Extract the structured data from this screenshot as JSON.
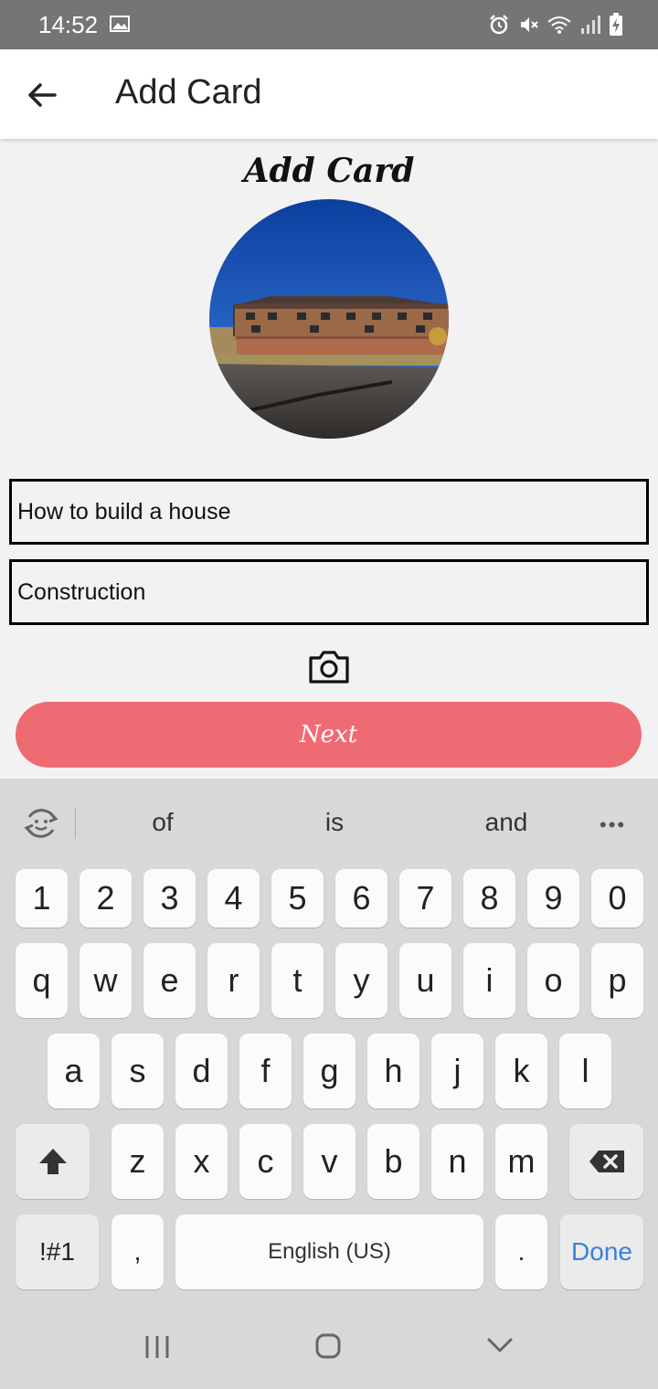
{
  "status_bar": {
    "time": "14:52",
    "icons": [
      "image-icon",
      "alarm-icon",
      "mute-icon",
      "wifi-icon",
      "signal-icon",
      "battery-icon"
    ]
  },
  "app_bar": {
    "title": "Add Card",
    "back_icon": "arrow-left-icon"
  },
  "content": {
    "script_title": "Add Card",
    "photo_description_icon": "house-photo",
    "title_field": {
      "value": "How to build a house"
    },
    "category_field": {
      "value": "Construction"
    },
    "camera_icon": "camera-icon",
    "next_label": "Next",
    "next_color": "#ef6b73"
  },
  "keyboard": {
    "suggestions": [
      "of",
      "is",
      "and"
    ],
    "number_row": [
      "1",
      "2",
      "3",
      "4",
      "5",
      "6",
      "7",
      "8",
      "9",
      "0"
    ],
    "row1": [
      "q",
      "w",
      "e",
      "r",
      "t",
      "y",
      "u",
      "i",
      "o",
      "p"
    ],
    "row2": [
      "a",
      "s",
      "d",
      "f",
      "g",
      "h",
      "j",
      "k",
      "l"
    ],
    "row3": [
      "z",
      "x",
      "c",
      "v",
      "b",
      "n",
      "m"
    ],
    "symbols_label": "!#1",
    "comma": ",",
    "space_label": "English (US)",
    "period": ".",
    "done_label": "Done",
    "done_color": "#3b7fe0"
  },
  "nav_bar": {
    "icons": [
      "recents-icon",
      "home-icon",
      "back-chevron-icon"
    ]
  }
}
